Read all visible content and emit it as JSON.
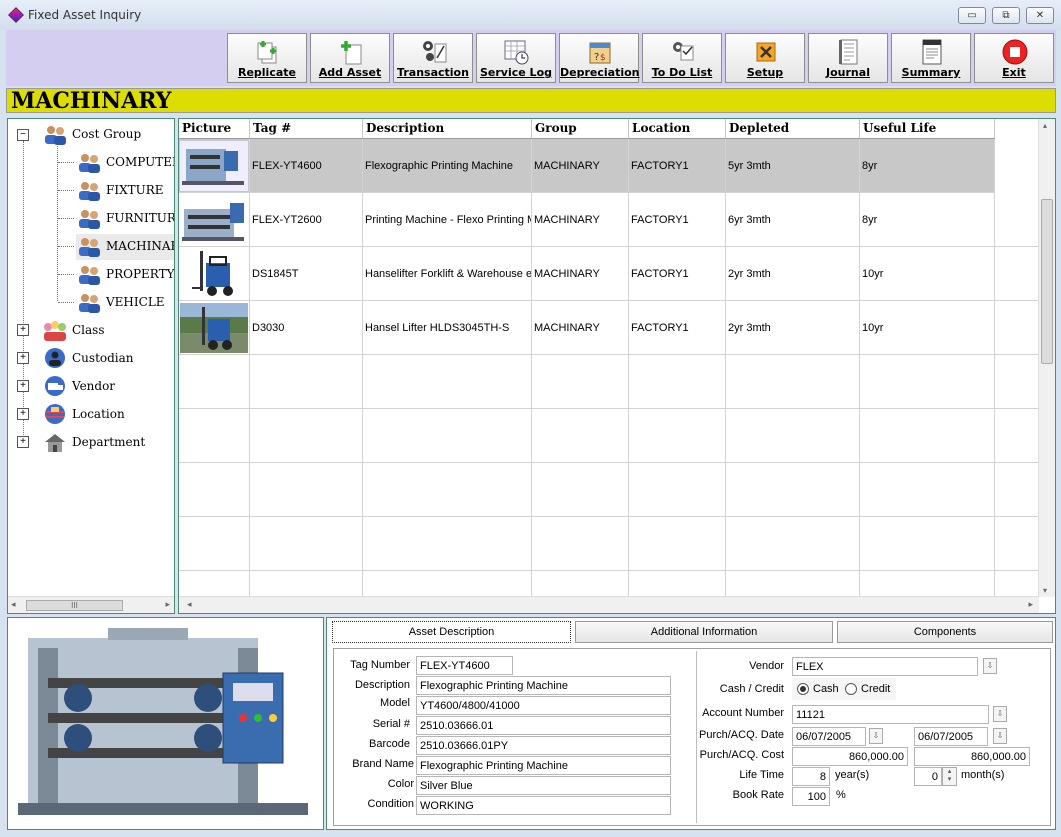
{
  "window": {
    "title": "Fixed Asset Inquiry",
    "min": "▭",
    "max": "⧉",
    "close": "✕"
  },
  "toolbar": [
    {
      "label": "Replicate",
      "icon": "replicate-icon"
    },
    {
      "label": "Add Asset",
      "icon": "add-asset-icon"
    },
    {
      "label": "Transaction",
      "icon": "transaction-icon"
    },
    {
      "label": "Service Log",
      "icon": "service-log-icon"
    },
    {
      "label": "Depreciation",
      "icon": "depreciation-icon"
    },
    {
      "label": "To Do List",
      "icon": "todo-icon"
    },
    {
      "label": "Setup",
      "icon": "setup-icon"
    },
    {
      "label": "Journal",
      "icon": "journal-icon"
    },
    {
      "label": "Summary",
      "icon": "summary-icon"
    },
    {
      "label": "Exit",
      "icon": "exit-icon"
    }
  ],
  "banner": "MACHINARY",
  "tree": {
    "cost_group": "Cost Group",
    "children": [
      "COMPUTER",
      "FIXTURE",
      "FURNITURE",
      "MACHINARY",
      "PROPERTY",
      "VEHICLE"
    ],
    "others": [
      "Class",
      "Custodian",
      "Vendor",
      "Location",
      "Department"
    ],
    "expanded_glyph": "−",
    "collapsed_glyph": "+",
    "scroll_thumb": "III"
  },
  "grid": {
    "headers": [
      "Picture",
      "Tag #",
      "Description",
      "Group",
      "Location",
      "Depleted",
      "Useful Life"
    ],
    "rows": [
      {
        "tag": "FLEX-YT4600",
        "description": "Flexographic Printing Machine",
        "group": "MACHINARY",
        "location": "FACTORY1",
        "depleted": "5yr 3mth",
        "life": "8yr"
      },
      {
        "tag": "FLEX-YT2600",
        "description": "Printing Machine - Flexo Printing Machine",
        "group": "MACHINARY",
        "location": "FACTORY1",
        "depleted": "6yr 3mth",
        "life": "8yr"
      },
      {
        "tag": "DS1845T",
        "description": "Hanselifter Forklift & Warehouse equipment",
        "group": "MACHINARY",
        "location": "FACTORY1",
        "depleted": "2yr 3mth",
        "life": "10yr"
      },
      {
        "tag": "D3030",
        "description": "Hansel Lifter HLDS3045TH-S",
        "group": "MACHINARY",
        "location": "FACTORY1",
        "depleted": "2yr 3mth",
        "life": "10yr"
      }
    ]
  },
  "tabs": [
    "Asset Description",
    "Additional Information",
    "Components"
  ],
  "detail": {
    "labels": {
      "tag": "Tag Number",
      "description": "Description",
      "model": "Model",
      "serial": "Serial #",
      "barcode": "Barcode",
      "brand": "Brand Name",
      "color": "Color",
      "condition": "Condition",
      "vendor": "Vendor",
      "cash_credit": "Cash / Credit",
      "cash": "Cash",
      "credit": "Credit",
      "account": "Account Number",
      "purch_date": "Purch/ACQ. Date",
      "purch_cost": "Purch/ACQ. Cost",
      "life_time": "Life Time",
      "years": "year(s)",
      "months": "month(s)",
      "book_rate": "Book Rate",
      "percent": "%"
    },
    "values": {
      "tag": "FLEX-YT4600",
      "description": "Flexographic Printing Machine",
      "model": "YT4600/4800/41000",
      "serial": "2510.03666.01",
      "barcode": "2510.03666.01PY",
      "brand": "Flexographic Printing Machine",
      "color": "Silver Blue",
      "condition": "WORKING",
      "vendor": "FLEX",
      "account": "11121",
      "purch_date": "06/07/2005",
      "purch_date2": "06/07/2005",
      "purch_cost": "860,000.00",
      "purch_cost2": "860,000.00",
      "life_years": "8",
      "life_months": "0",
      "book_rate": "100"
    }
  },
  "colors": {
    "banner": "#dddd00",
    "toolbar_bg": "#d4cff1",
    "panel_border": "#4c8b6f",
    "selected_row": "#c8c8c8"
  }
}
